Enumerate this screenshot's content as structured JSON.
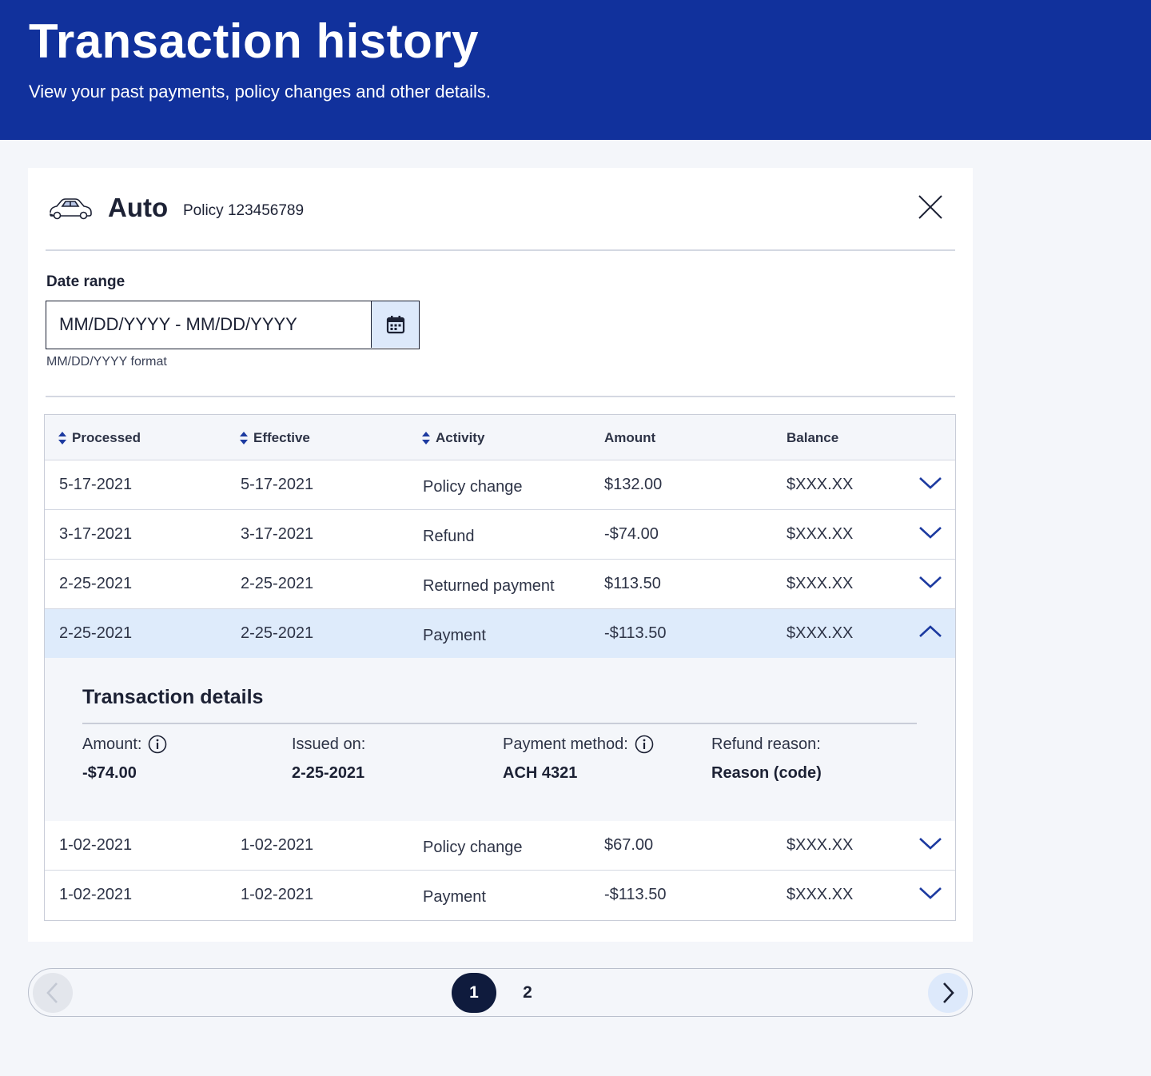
{
  "header": {
    "title": "Transaction history",
    "subtitle": "View your past payments, policy changes and other details."
  },
  "policy": {
    "product": "Auto",
    "policy_number": "Policy 123456789"
  },
  "date_range": {
    "label": "Date range",
    "placeholder": "MM/DD/YYYY - MM/DD/YYYY",
    "hint": "MM/DD/YYYY format"
  },
  "table": {
    "columns": [
      "Processed",
      "Effective",
      "Activity",
      "Amount",
      "Balance"
    ],
    "rows": [
      {
        "processed": "5-17-2021",
        "effective": "5-17-2021",
        "activity": "Policy change",
        "amount": "$132.00",
        "balance": "$XXX.XX"
      },
      {
        "processed": "3-17-2021",
        "effective": "3-17-2021",
        "activity": "Refund",
        "amount": "-$74.00",
        "balance": "$XXX.XX"
      },
      {
        "processed": "2-25-2021",
        "effective": "2-25-2021",
        "activity": "Returned payment",
        "amount": "$113.50",
        "balance": "$XXX.XX"
      },
      {
        "processed": "2-25-2021",
        "effective": "2-25-2021",
        "activity": "Payment",
        "amount": "-$113.50",
        "balance": "$XXX.XX"
      },
      {
        "processed": "1-02-2021",
        "effective": "1-02-2021",
        "activity": "Policy change",
        "amount": "$67.00",
        "balance": "$XXX.XX"
      },
      {
        "processed": "1-02-2021",
        "effective": "1-02-2021",
        "activity": "Payment",
        "amount": "-$113.50",
        "balance": "$XXX.XX"
      }
    ],
    "expanded_row": 3
  },
  "details": {
    "title": "Transaction details",
    "fields": [
      {
        "label": "Amount:",
        "value": "-$74.00"
      },
      {
        "label": "Issued on:",
        "value": "2-25-2021"
      },
      {
        "label": "Payment method:",
        "value": "ACH 4321"
      },
      {
        "label": "Refund reason:",
        "value": "Reason (code)"
      }
    ]
  },
  "pagination": {
    "pages": [
      "1",
      "2"
    ],
    "current": "1"
  },
  "colors": {
    "brand": "#11319c",
    "accent": "#1c3aa0",
    "highlight_row": "#deebfb",
    "current_page": "#0f1b3d"
  },
  "icons": {
    "product": "car-icon",
    "close": "close-icon",
    "calendar": "calendar-icon",
    "sort": "sort-icon",
    "expand": "chevron-down-icon",
    "collapse": "chevron-up-icon",
    "info": "info-icon",
    "prev": "chevron-left-icon",
    "next": "chevron-right-icon"
  }
}
